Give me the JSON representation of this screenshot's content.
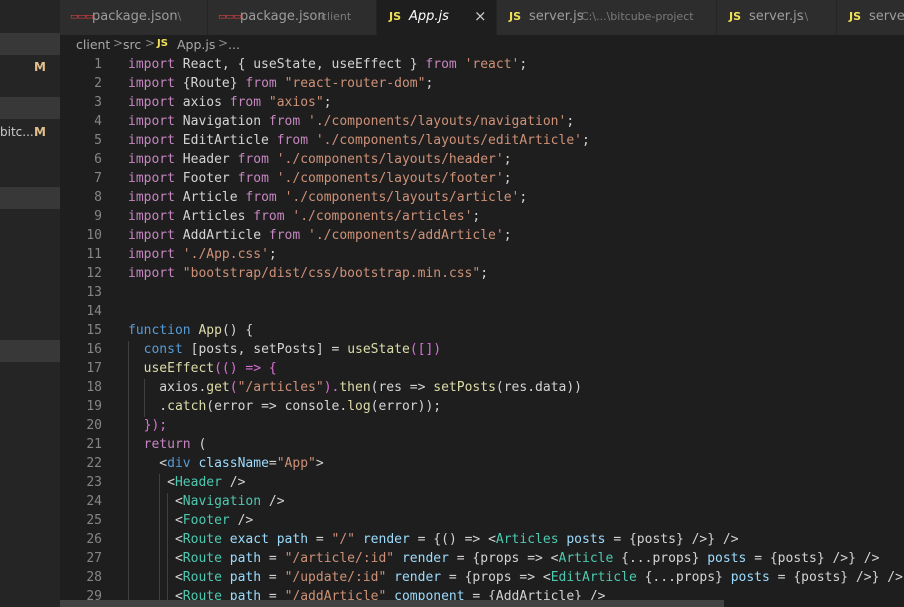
{
  "sidebar": {
    "items": [
      {
        "text": "",
        "badge": "M"
      },
      {
        "text": "bitc...",
        "badge": "M"
      }
    ]
  },
  "tabs": [
    {
      "label": "package.json",
      "description": ".\\",
      "icon": "json-icon",
      "active": false
    },
    {
      "label": "package.json",
      "description": "client",
      "icon": "json-icon",
      "active": false
    },
    {
      "label": "App.js",
      "description": "",
      "icon": "js-icon",
      "active": true,
      "close": "×"
    },
    {
      "label": "server.js",
      "description": "C:\\...\\bitcube-project",
      "icon": "js-icon",
      "active": false
    },
    {
      "label": "server.js",
      "description": ".\\",
      "icon": "js-icon",
      "active": false
    },
    {
      "label": "server.js",
      "description": "",
      "icon": "js-icon",
      "active": false
    }
  ],
  "icons": {
    "json": "▭▭▭",
    "js": "JS"
  },
  "breadcrumb": {
    "items": [
      "client",
      "src",
      "App.js",
      "..."
    ],
    "separator": ">"
  },
  "colors": {
    "keyword": "#c586c0",
    "storage": "#569cd6",
    "string": "#ce9178",
    "function": "#dcdcaa",
    "variable": "#9cdcfe",
    "component": "#4ec9b0",
    "tag": "#569cd6",
    "plain": "#d4d4d4",
    "bracket_gold": "#ffd700",
    "bracket_pink": "#da70d6",
    "bracket_blue": "#179fff"
  },
  "code": {
    "lines": [
      {
        "n": "1",
        "t": [
          [
            "import",
            "k"
          ],
          [
            " React, { useState, useEffect } ",
            "p"
          ],
          [
            "from",
            "k"
          ],
          [
            " ",
            "p"
          ],
          [
            "'react'",
            "s"
          ],
          [
            ";",
            "p"
          ]
        ]
      },
      {
        "n": "2",
        "t": [
          [
            "import",
            "k"
          ],
          [
            " {Route} ",
            "p"
          ],
          [
            "from",
            "k"
          ],
          [
            " ",
            "p"
          ],
          [
            "\"react-router-dom\"",
            "s"
          ],
          [
            ";",
            "p"
          ]
        ]
      },
      {
        "n": "3",
        "t": [
          [
            "import",
            "k"
          ],
          [
            " axios ",
            "p"
          ],
          [
            "from",
            "k"
          ],
          [
            " ",
            "p"
          ],
          [
            "\"axios\"",
            "s"
          ],
          [
            ";",
            "p"
          ]
        ]
      },
      {
        "n": "4",
        "t": [
          [
            "import",
            "k"
          ],
          [
            " Navigation ",
            "p"
          ],
          [
            "from",
            "k"
          ],
          [
            " ",
            "p"
          ],
          [
            "'./components/layouts/navigation'",
            "s"
          ],
          [
            ";",
            "p"
          ]
        ]
      },
      {
        "n": "5",
        "t": [
          [
            "import",
            "k"
          ],
          [
            " EditArticle ",
            "p"
          ],
          [
            "from",
            "k"
          ],
          [
            " ",
            "p"
          ],
          [
            "'./components/layouts/editArticle'",
            "s"
          ],
          [
            ";",
            "p"
          ]
        ]
      },
      {
        "n": "6",
        "t": [
          [
            "import",
            "k"
          ],
          [
            " Header ",
            "p"
          ],
          [
            "from",
            "k"
          ],
          [
            " ",
            "p"
          ],
          [
            "'./components/layouts/header'",
            "s"
          ],
          [
            ";",
            "p"
          ]
        ]
      },
      {
        "n": "7",
        "t": [
          [
            "import",
            "k"
          ],
          [
            " Footer ",
            "p"
          ],
          [
            "from",
            "k"
          ],
          [
            " ",
            "p"
          ],
          [
            "'./components/layouts/footer'",
            "s"
          ],
          [
            ";",
            "p"
          ]
        ]
      },
      {
        "n": "8",
        "t": [
          [
            "import",
            "k"
          ],
          [
            " Article ",
            "p"
          ],
          [
            "from",
            "k"
          ],
          [
            " ",
            "p"
          ],
          [
            "'./components/layouts/article'",
            "s"
          ],
          [
            ";",
            "p"
          ]
        ]
      },
      {
        "n": "9",
        "t": [
          [
            "import",
            "k"
          ],
          [
            " Articles ",
            "p"
          ],
          [
            "from",
            "k"
          ],
          [
            " ",
            "p"
          ],
          [
            "'./components/articles'",
            "s"
          ],
          [
            ";",
            "p"
          ]
        ]
      },
      {
        "n": "10",
        "t": [
          [
            "import",
            "k"
          ],
          [
            " AddArticle ",
            "p"
          ],
          [
            "from",
            "k"
          ],
          [
            " ",
            "p"
          ],
          [
            "'./components/addArticle'",
            "s"
          ],
          [
            ";",
            "p"
          ]
        ]
      },
      {
        "n": "11",
        "t": [
          [
            "import",
            "k"
          ],
          [
            " ",
            "p"
          ],
          [
            "'./App.css'",
            "s"
          ],
          [
            ";",
            "p"
          ]
        ]
      },
      {
        "n": "12",
        "t": [
          [
            "import",
            "k"
          ],
          [
            " ",
            "p"
          ],
          [
            "\"bootstrap/dist/css/bootstrap.min.css\"",
            "s"
          ],
          [
            ";",
            "p"
          ]
        ]
      },
      {
        "n": "13",
        "t": []
      },
      {
        "n": "14",
        "t": []
      },
      {
        "n": "15",
        "t": [
          [
            "function",
            "c"
          ],
          [
            " ",
            "p"
          ],
          [
            "App",
            "f"
          ],
          [
            "() {",
            "p"
          ]
        ]
      },
      {
        "n": "16",
        "t": [
          [
            "  ",
            "p"
          ],
          [
            "const",
            "c"
          ],
          [
            " [",
            "p"
          ],
          [
            "posts",
            "p"
          ],
          [
            ", ",
            "p"
          ],
          [
            "setPosts",
            "p"
          ],
          [
            "] = ",
            "p"
          ],
          [
            "useState",
            "f"
          ],
          [
            "([])",
            "g"
          ]
        ]
      },
      {
        "n": "17",
        "t": [
          [
            "  ",
            "p"
          ],
          [
            "useEffect",
            "f"
          ],
          [
            "(() => {",
            "g"
          ]
        ]
      },
      {
        "n": "18",
        "t": [
          [
            "    axios.",
            "p"
          ],
          [
            "get",
            "f"
          ],
          [
            "(",
            "g"
          ],
          [
            "\"/articles\"",
            "s"
          ],
          [
            ").",
            "g"
          ],
          [
            "then",
            "f"
          ],
          [
            "(res => ",
            "p"
          ],
          [
            "setPosts",
            "f"
          ],
          [
            "(res.data))",
            "p"
          ]
        ]
      },
      {
        "n": "19",
        "t": [
          [
            "    .",
            "p"
          ],
          [
            "catch",
            "f"
          ],
          [
            "(error => ",
            "p"
          ],
          [
            "console",
            "p"
          ],
          [
            ".",
            "p"
          ],
          [
            "log",
            "f"
          ],
          [
            "(error));",
            "p"
          ]
        ]
      },
      {
        "n": "20",
        "t": [
          [
            "  ",
            "p"
          ],
          [
            "});",
            "g"
          ]
        ]
      },
      {
        "n": "21",
        "t": [
          [
            "  ",
            "p"
          ],
          [
            "return",
            "k"
          ],
          [
            " (",
            "p"
          ]
        ]
      },
      {
        "n": "22",
        "t": [
          [
            "    <",
            "p"
          ],
          [
            "div",
            "t"
          ],
          [
            " ",
            "p"
          ],
          [
            "className",
            "v"
          ],
          [
            "=",
            "p"
          ],
          [
            "\"App\"",
            "s"
          ],
          [
            ">",
            "p"
          ]
        ]
      },
      {
        "n": "23",
        "t": [
          [
            "     <",
            "p"
          ],
          [
            "Header",
            "m"
          ],
          [
            " />",
            "p"
          ]
        ]
      },
      {
        "n": "24",
        "t": [
          [
            "      <",
            "p"
          ],
          [
            "Navigation",
            "m"
          ],
          [
            " />",
            "p"
          ]
        ]
      },
      {
        "n": "25",
        "t": [
          [
            "      <",
            "p"
          ],
          [
            "Footer",
            "m"
          ],
          [
            " />",
            "p"
          ]
        ]
      },
      {
        "n": "26",
        "t": [
          [
            "      <",
            "p"
          ],
          [
            "Route",
            "m"
          ],
          [
            " ",
            "p"
          ],
          [
            "exact",
            "v"
          ],
          [
            " ",
            "p"
          ],
          [
            "path",
            "v"
          ],
          [
            " = ",
            "p"
          ],
          [
            "\"/\"",
            "s"
          ],
          [
            " ",
            "p"
          ],
          [
            "render",
            "v"
          ],
          [
            " = {() => <",
            "p"
          ],
          [
            "Articles",
            "m"
          ],
          [
            " ",
            "p"
          ],
          [
            "posts",
            "v"
          ],
          [
            " = {posts} />} />",
            "p"
          ]
        ]
      },
      {
        "n": "27",
        "t": [
          [
            "      <",
            "p"
          ],
          [
            "Route",
            "m"
          ],
          [
            " ",
            "p"
          ],
          [
            "path",
            "v"
          ],
          [
            " = ",
            "p"
          ],
          [
            "\"/article/:id\"",
            "s"
          ],
          [
            " ",
            "p"
          ],
          [
            "render",
            "v"
          ],
          [
            " = {props => <",
            "p"
          ],
          [
            "Article",
            "m"
          ],
          [
            " {...props} ",
            "p"
          ],
          [
            "posts",
            "v"
          ],
          [
            " = {posts} />} />",
            "p"
          ]
        ]
      },
      {
        "n": "28",
        "t": [
          [
            "      <",
            "p"
          ],
          [
            "Route",
            "m"
          ],
          [
            " ",
            "p"
          ],
          [
            "path",
            "v"
          ],
          [
            " = ",
            "p"
          ],
          [
            "\"/update/:id\"",
            "s"
          ],
          [
            " ",
            "p"
          ],
          [
            "render",
            "v"
          ],
          [
            " = {props => <",
            "p"
          ],
          [
            "EditArticle",
            "m"
          ],
          [
            " {...props} ",
            "p"
          ],
          [
            "posts",
            "v"
          ],
          [
            " = {posts} />} />",
            "p"
          ]
        ]
      },
      {
        "n": "29",
        "t": [
          [
            "      <",
            "p"
          ],
          [
            "Route",
            "m"
          ],
          [
            " ",
            "p"
          ],
          [
            "path",
            "v"
          ],
          [
            " = ",
            "p"
          ],
          [
            "\"/addArticle\"",
            "s"
          ],
          [
            " ",
            "p"
          ],
          [
            "component",
            "v"
          ],
          [
            " = {AddArticle} />",
            "p"
          ]
        ]
      }
    ]
  }
}
